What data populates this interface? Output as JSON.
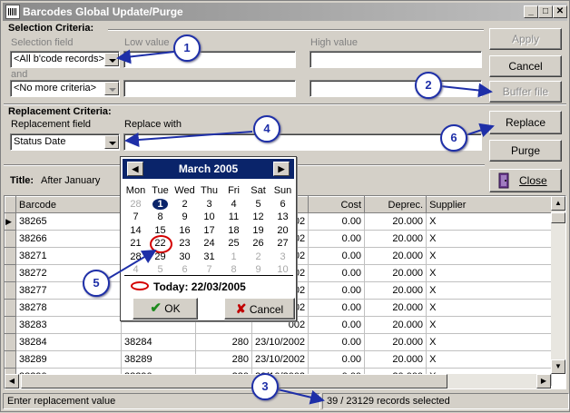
{
  "window": {
    "title": "Barcodes Global Update/Purge"
  },
  "selection": {
    "heading": "Selection Criteria:",
    "field_label": "Selection field",
    "low_label": "Low value",
    "high_label": "High value",
    "field_value": "<All b'code records>",
    "and_label": "and",
    "field2_value": "<No more criteria>"
  },
  "replacement": {
    "heading": "Replacement Criteria:",
    "field_label": "Replacement field",
    "replace_label": "Replace with",
    "field_value": "Status Date"
  },
  "buttons": {
    "apply": "Apply",
    "cancel": "Cancel",
    "buffer": "Buffer file",
    "replace": "Replace",
    "purge": "Purge",
    "close": "Close"
  },
  "title_row": {
    "label": "Title:",
    "value": "After January"
  },
  "grid": {
    "columns": [
      "Barcode",
      "",
      "",
      "",
      "Cost",
      "Deprec.",
      "Supplier"
    ],
    "rows": [
      [
        "38265",
        "",
        "",
        "002",
        "0.00",
        "20.000",
        "X"
      ],
      [
        "38266",
        "",
        "",
        "002",
        "0.00",
        "20.000",
        "X"
      ],
      [
        "38271",
        "",
        "",
        "002",
        "0.00",
        "20.000",
        "X"
      ],
      [
        "38272",
        "",
        "",
        "002",
        "0.00",
        "20.000",
        "X"
      ],
      [
        "38277",
        "",
        "",
        "002",
        "0.00",
        "20.000",
        "X"
      ],
      [
        "38278",
        "",
        "",
        "002",
        "0.00",
        "20.000",
        "X"
      ],
      [
        "38283",
        "",
        "",
        "002",
        "0.00",
        "20.000",
        "X"
      ],
      [
        "38284",
        "38284",
        "280",
        "23/10/2002",
        "0.00",
        "20.000",
        "X"
      ],
      [
        "38289",
        "38289",
        "280",
        "23/10/2002",
        "0.00",
        "20.000",
        "X"
      ],
      [
        "38290",
        "38290",
        "280",
        "23/10/2002",
        "0.00",
        "20.000",
        "X"
      ]
    ]
  },
  "calendar": {
    "month": "March 2005",
    "dows": [
      "Mon",
      "Tue",
      "Wed",
      "Thu",
      "Fri",
      "Sat",
      "Sun"
    ],
    "weeks": [
      [
        "28",
        "1",
        "2",
        "3",
        "4",
        "5",
        "6"
      ],
      [
        "7",
        "8",
        "9",
        "10",
        "11",
        "12",
        "13"
      ],
      [
        "14",
        "15",
        "16",
        "17",
        "18",
        "19",
        "20"
      ],
      [
        "21",
        "22",
        "23",
        "24",
        "25",
        "26",
        "27"
      ],
      [
        "28",
        "29",
        "30",
        "31",
        "1",
        "2",
        "3"
      ],
      [
        "4",
        "5",
        "6",
        "7",
        "8",
        "9",
        "10"
      ]
    ],
    "today_text": "Today: 22/03/2005",
    "ok": "OK",
    "cancel": "Cancel"
  },
  "status": {
    "hint": "Enter replacement value",
    "records": "39 / 23129 records selected"
  },
  "callouts": [
    "1",
    "2",
    "3",
    "4",
    "5",
    "6"
  ],
  "colors": {
    "callout": "#1e2fa8",
    "header": "#0a246a",
    "today_ring": "#d40000"
  }
}
